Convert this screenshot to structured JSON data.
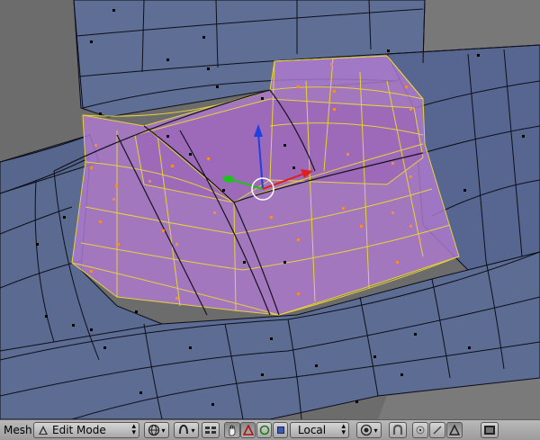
{
  "header": {
    "menu_label": "Mesh",
    "mode_select": {
      "value": "Edit Mode"
    },
    "orientation_select": {
      "value": "Local"
    }
  },
  "icons": {
    "mode": "triangle-mode-icon",
    "draw_type": "sphere-draw-type-icon",
    "pivot": "pivot-point-icon",
    "layers": "layer-toggle-icon",
    "manipulator": "hand-manipulator-icon",
    "translate": "translate-triangle-icon",
    "rotate": "rotate-circle-icon",
    "scale": "scale-square-icon",
    "proportional": "proportional-edit-icon",
    "snap": "snap-magnet-icon",
    "vertex_select": "vertex-select-icon",
    "edge_select": "edge-select-icon",
    "face_select": "face-select-icon",
    "render": "render-icon"
  },
  "colors": {
    "mesh_fill": "#5a6a8f",
    "mesh_wire": "#0e0e18",
    "selection_fill": "#b07ad0",
    "selection_wire": "#e6d23a",
    "selected_vertex": "#ff8a28",
    "unselected_vertex": "#000000",
    "axis_x": "#e02020",
    "axis_y": "#20c020",
    "axis_z": "#2040e0",
    "header_bg": "#a8a8a8"
  }
}
